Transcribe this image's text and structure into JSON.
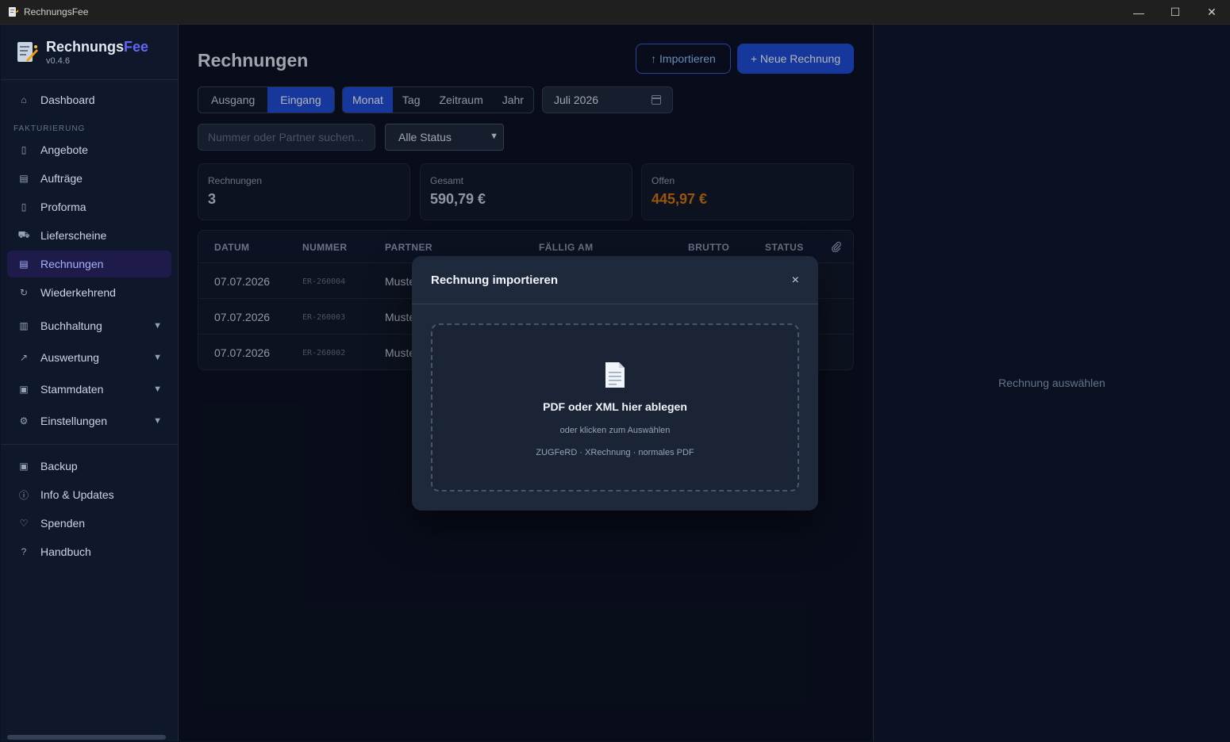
{
  "window": {
    "title": "RechnungsFee",
    "minimize": "—",
    "maximize": "☐",
    "close": "✕"
  },
  "brand": {
    "name_main": "Rechnungs",
    "name_accent": "Fee",
    "version": "v0.4.6"
  },
  "sidebar": {
    "dashboard": "Dashboard",
    "section_billing": "FAKTURIERUNG",
    "items": [
      "Angebote",
      "Aufträge",
      "Proforma",
      "Lieferscheine",
      "Rechnungen",
      "Wiederkehrend"
    ],
    "groups": [
      "Buchhaltung",
      "Auswertung",
      "Stammdaten",
      "Einstellungen"
    ],
    "bottom": [
      "Backup",
      "Info & Updates",
      "Spenden",
      "Handbuch"
    ]
  },
  "main": {
    "title": "Rechnungen",
    "import_button": "↑ Importieren",
    "new_button": "+ Neue Rechnung",
    "direction": [
      "Ausgang",
      "Eingang"
    ],
    "direction_active": "Eingang",
    "period": [
      "Monat",
      "Tag",
      "Zeitraum",
      "Jahr"
    ],
    "period_active": "Monat",
    "date_value": "Juli 2026",
    "search_placeholder": "Nummer oder Partner suchen...",
    "status_select": "Alle Status"
  },
  "stats": [
    {
      "label": "Rechnungen",
      "value": "3"
    },
    {
      "label": "Gesamt",
      "value": "590,79 €"
    },
    {
      "label": "Offen",
      "value": "445,97 €"
    }
  ],
  "table": {
    "headers": [
      "DATUM",
      "NUMMER",
      "PARTNER",
      "FÄLLIG AM",
      "BRUTTO",
      "STATUS"
    ],
    "rows": [
      {
        "date": "07.07.2026",
        "number": "ER-260004",
        "partner": "Muste"
      },
      {
        "date": "07.07.2026",
        "number": "ER-260003",
        "partner": "Muste"
      },
      {
        "date": "07.07.2026",
        "number": "ER-260002",
        "partner": "Muste"
      }
    ]
  },
  "detail": {
    "empty_text": "Rechnung auswählen"
  },
  "modal": {
    "title": "Rechnung importieren",
    "close": "×",
    "drop_title": "PDF oder XML hier ablegen",
    "drop_sub": "oder klicken zum Auswählen",
    "drop_formats": "ZUGFeRD · XRechnung · normales PDF"
  },
  "colors": {
    "accent": "#1d4ed8",
    "brand_accent": "#6366f1",
    "open_amount": "#d97706",
    "active_nav_bg": "#1e1b4b"
  }
}
